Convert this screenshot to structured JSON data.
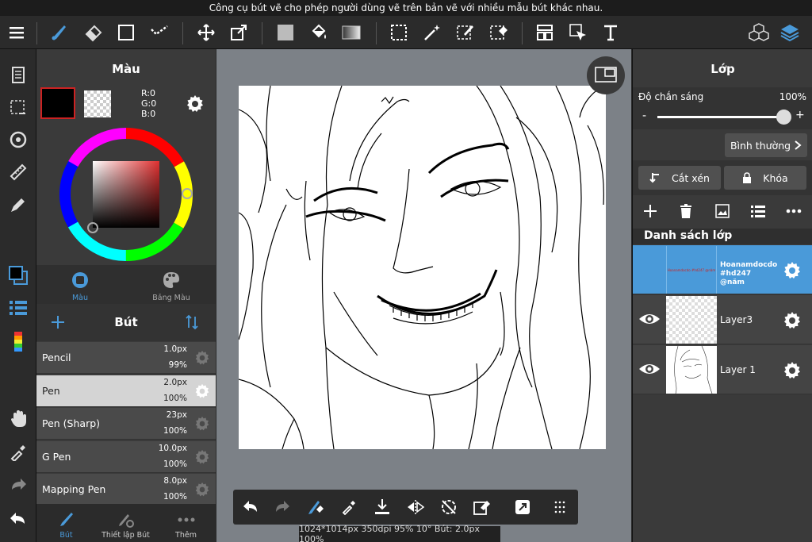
{
  "tooltip": "Công cụ bút vẽ cho phép người dùng vẽ trên bản vẽ với nhiều mẫu bút khác nhau.",
  "toolbar_icons": [
    "menu-icon",
    "brush-icon",
    "eraser-icon",
    "rectangle-icon",
    "dot-brush-icon",
    "move-icon",
    "transform-icon",
    "fill-color-icon",
    "bucket-icon",
    "gradient-icon",
    "select-rect-icon",
    "magic-wand-icon",
    "select-pen-icon",
    "select-eraser-icon",
    "layout-icon",
    "pointer-icon",
    "text-icon",
    "materials-icon",
    "layers-icon"
  ],
  "color_panel": {
    "title": "Màu",
    "rgb_r": "R:0",
    "rgb_g": "G:0",
    "rgb_b": "B:0",
    "primary_color": "#000000",
    "tab_color": "Màu",
    "tab_palette": "Bảng Màu"
  },
  "brush_panel": {
    "title": "Bút",
    "brushes": [
      {
        "name": "Pencil",
        "size": "1.0px",
        "opacity": "99%"
      },
      {
        "name": "Pen",
        "size": "2.0px",
        "opacity": "100%"
      },
      {
        "name": "Pen (Sharp)",
        "size": "23px",
        "opacity": "100%"
      },
      {
        "name": "G Pen",
        "size": "10.0px",
        "opacity": "100%"
      },
      {
        "name": "Mapping Pen",
        "size": "8.0px",
        "opacity": "100%"
      }
    ],
    "selected_index": 1,
    "tab_brush": "Bút",
    "tab_settings": "Thiết lập Bút",
    "tab_more": "Thêm"
  },
  "layer_panel": {
    "title": "Lớp",
    "opacity_label": "Độ chắn sáng",
    "opacity_value": "100%",
    "opacity_fraction": 1.0,
    "minus": "-",
    "plus": "+",
    "blend_mode": "Bình thường",
    "clip_label": "Cắt xén",
    "lock_label": "Khóa",
    "list_title": "Danh sách lớp",
    "layers": [
      {
        "name": "Hoanamdocdo #hd247 @năm",
        "visible": false,
        "selected": true
      },
      {
        "name": "Layer3",
        "visible": true,
        "selected": false
      },
      {
        "name": "Layer 1",
        "visible": true,
        "selected": false
      }
    ],
    "thumb_text": "Hoanamdocdo #hd247 @năm"
  },
  "status_bar": "1024*1014px 350dpi 95% 10° Bút: 2.0px 100%",
  "colors": {
    "accent": "#4a9ad9",
    "selected_layer": "#4a9ad9",
    "panel": "#3a3a3a"
  }
}
